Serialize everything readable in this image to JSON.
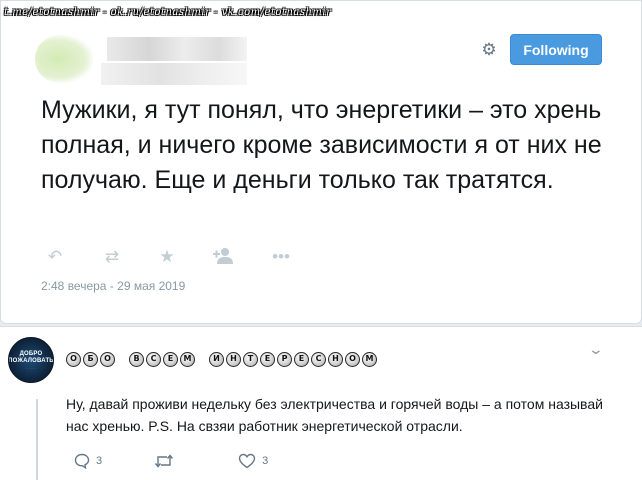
{
  "watermark": "t.me/etotnashmir - ok.ru/etotnashmir - vk.com/etotnashmir",
  "tweet": {
    "follow_label": "Following",
    "text": "Мужики, я тут понял, что энергетики – это хрень полная, и ничего кроме зависимости я от них не получаю. Еще и деньги только так тратятся.",
    "timestamp": "2:48 вечера - 29 мая 2019",
    "icons": {
      "settings": "gear-icon",
      "reply": "reply-icon",
      "retweet": "retweet-icon",
      "like": "star-icon",
      "follow": "add-user-icon",
      "more": "more-icon"
    },
    "colors": {
      "follow_button": "#4a9ae0",
      "text": "#14171a",
      "muted": "#8899a6"
    }
  },
  "reply": {
    "group_name_letters": [
      "О",
      "Б",
      "О",
      " ",
      "В",
      "С",
      "Е",
      "М",
      " ",
      "И",
      "Н",
      "Т",
      "Е",
      "Р",
      "Е",
      "С",
      "Н",
      "О",
      "М"
    ],
    "avatar_line1": "Добро",
    "avatar_line2": "пожаловать",
    "text": "Ну, давай проживи недельку без электричества и горячей воды – а потом называй нас хренью. P.S. На свзяи работник энергетической отрасли.",
    "comments_count": "3",
    "likes_count": "3",
    "icons": {
      "menu": "chevron-down-icon",
      "comment": "comment-icon",
      "repost": "repost-icon",
      "like": "heart-icon"
    }
  }
}
